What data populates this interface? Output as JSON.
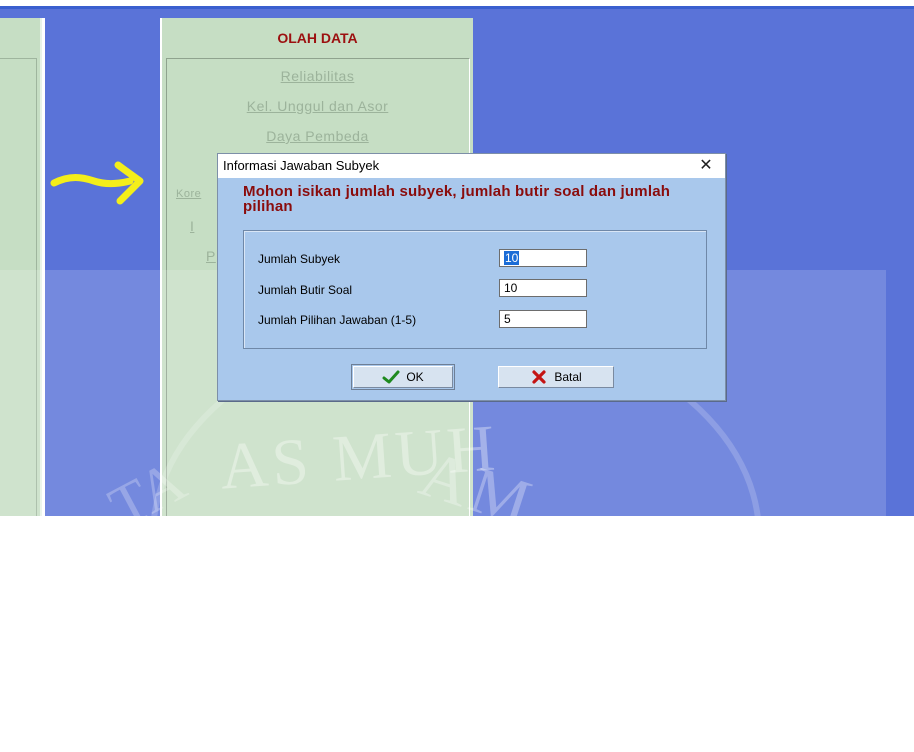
{
  "menu": {
    "title": "OLAH DATA",
    "items": [
      {
        "label": "Reliabilitas"
      },
      {
        "label": "Kel. Unggul dan Asor"
      },
      {
        "label": "Daya Pembeda"
      }
    ],
    "partial_labels": {
      "kore": "Kore",
      "p1": "P",
      "p2": "P",
      "i": "I"
    }
  },
  "dialog": {
    "title": "Informasi Jawaban Subyek",
    "close_glyph": "✕",
    "heading": "Mohon isikan jumlah subyek, jumlah butir soal dan jumlah pilihan",
    "fields": [
      {
        "label": "Jumlah Subyek",
        "value": "10"
      },
      {
        "label": "Jumlah Butir Soal",
        "value": "10"
      },
      {
        "label": "Jumlah Pilihan Jawaban (1-5)",
        "value": "5"
      }
    ],
    "ok_label": "OK",
    "cancel_label": "Batal"
  },
  "watermark": {
    "text_left": "AS MUH",
    "text_right": "AM",
    "text_far_left": "TA"
  },
  "colors": {
    "accent_blue": "#5a73d8",
    "panel_green": "#c6dec4",
    "heading_red": "#8a0c0c",
    "dialog_blue": "#a9c8ec",
    "arrow_yellow": "#f4ee1a"
  },
  "icons": {
    "ok": "check-icon",
    "cancel": "x-icon",
    "arrow": "right-arrow-icon"
  }
}
